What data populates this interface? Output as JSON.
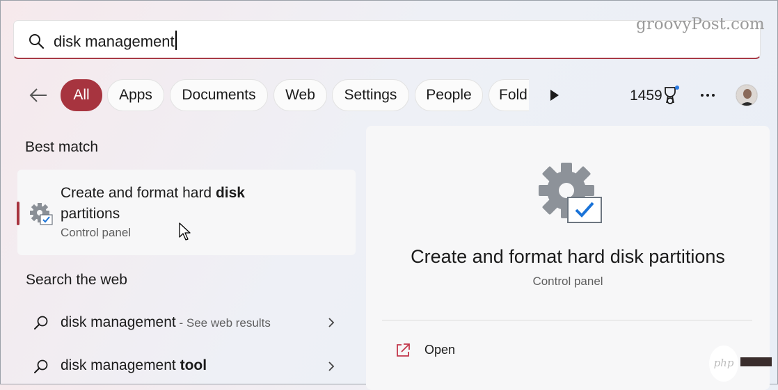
{
  "search": {
    "query": "disk management"
  },
  "watermark": "groovyPost.com",
  "filters": [
    "All",
    "Apps",
    "Documents",
    "Web",
    "Settings",
    "People",
    "Fold"
  ],
  "points": "1459",
  "best_match": {
    "heading": "Best match",
    "title_plain": "Create and format hard ",
    "title_bold": "disk",
    "title_line2": "partitions",
    "subtitle": "Control panel"
  },
  "web": {
    "heading": "Search the web",
    "results": [
      {
        "text": "disk management",
        "hint": " - See web results",
        "bold": ""
      },
      {
        "text": "disk management ",
        "hint": "",
        "bold": "tool"
      }
    ]
  },
  "detail": {
    "title": "Create and format hard disk partitions",
    "subtitle": "Control panel",
    "action_open": "Open"
  },
  "badge": "php",
  "colors": {
    "accent": "#a7343f"
  }
}
